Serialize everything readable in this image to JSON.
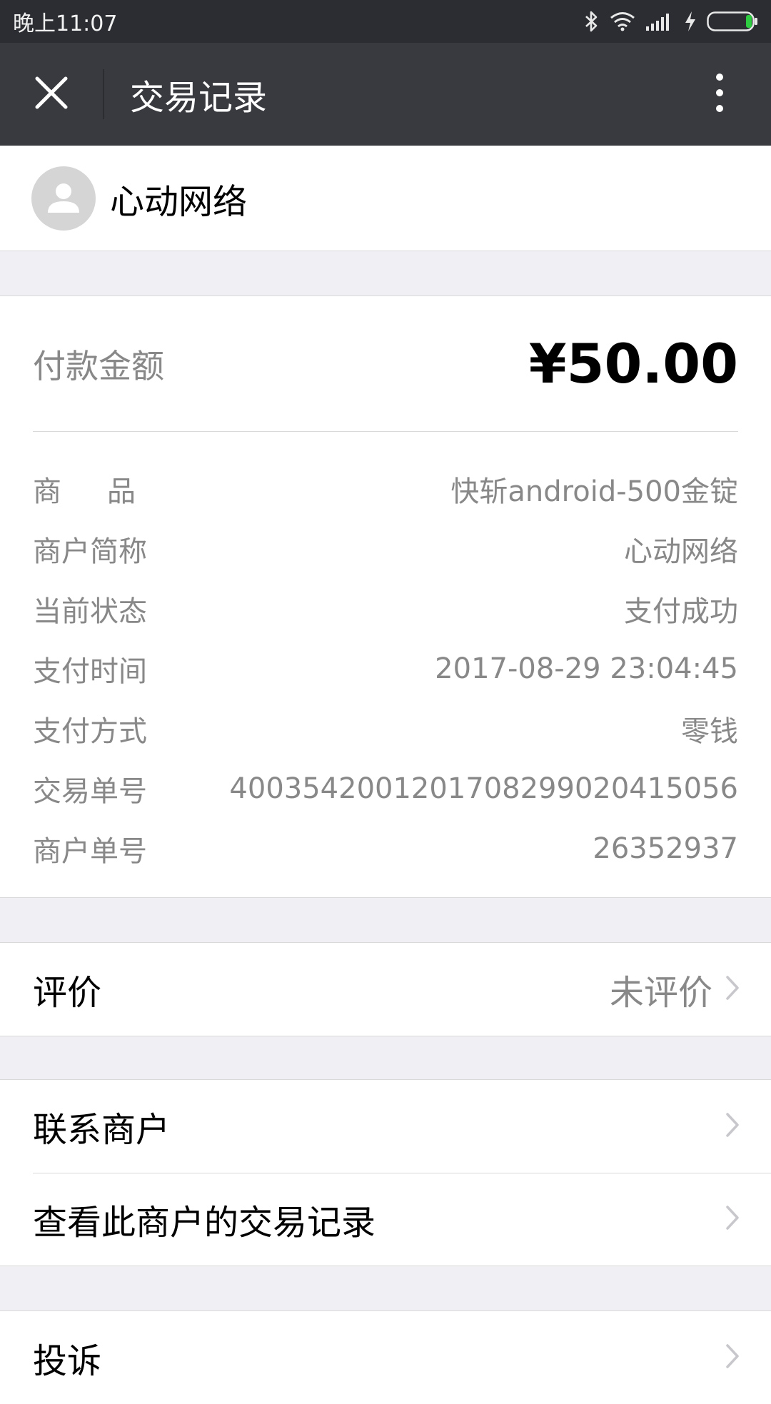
{
  "status_bar": {
    "time": "晚上11:07",
    "icons": [
      "bluetooth-icon",
      "wifi-icon",
      "signal-icon",
      "charging-icon",
      "battery-icon"
    ]
  },
  "nav": {
    "title": "交易记录",
    "close_icon": "close-icon",
    "more_icon": "more-vertical-icon"
  },
  "merchant": {
    "name": "心动网络"
  },
  "payment": {
    "amount_label": "付款金额",
    "amount_value": "¥50.00"
  },
  "details": [
    {
      "label": "商品",
      "value": "快斩android-500金锭"
    },
    {
      "label": "商户简称",
      "value": "心动网络"
    },
    {
      "label": "当前状态",
      "value": "支付成功"
    },
    {
      "label": "支付时间",
      "value": "2017-08-29 23:04:45"
    },
    {
      "label": "支付方式",
      "value": "零钱"
    },
    {
      "label": "交易单号",
      "value": "4003542001201708299020415056"
    },
    {
      "label": "商户单号",
      "value": "26352937"
    }
  ],
  "review": {
    "label": "评价",
    "value": "未评价"
  },
  "actions": {
    "contact_label": "联系商户",
    "history_label": "查看此商户的交易记录"
  },
  "complaint": {
    "label": "投诉"
  },
  "colors": {
    "status_bar": "#2b2d32",
    "nav_bar": "#393a3f",
    "background": "#efeff4",
    "secondary_text": "#888888",
    "battery_green": "#2ecc40"
  }
}
